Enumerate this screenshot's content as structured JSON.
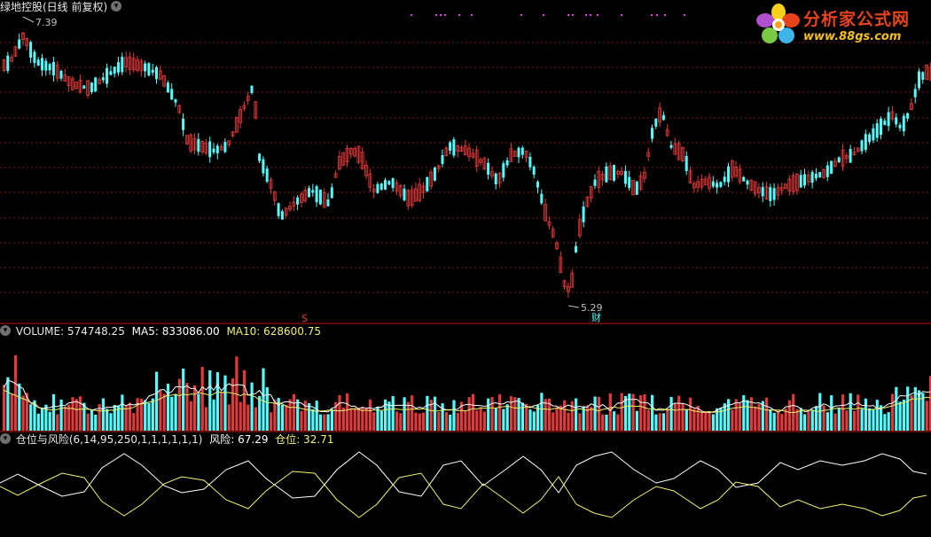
{
  "main_panel": {
    "title": "绿地控股(日线 前复权)",
    "high_label": "7.39",
    "low_label": "5.29",
    "marker_s": "S",
    "marker_cai": "财",
    "colors": {
      "up": "#e23a3a",
      "down": "#53fdfd",
      "grid": "#7a1a1a",
      "divider": "#c01010"
    }
  },
  "volume_panel": {
    "label": "VOLUME: 574748.25",
    "ma5": "MA5: 833086.00",
    "ma10": "MA10: 628600.75",
    "colors": {
      "ma5": "#ffffff",
      "ma10": "#f2f26b"
    }
  },
  "indicator_panel": {
    "name": "仓位与风险(6,14,95,250,1,1,1,1,1,1)",
    "risk": "风险: 67.29",
    "position": "仓位: 32.71",
    "colors": {
      "risk": "#ffffff",
      "position": "#f2f26b"
    }
  },
  "logo": {
    "title": "分析家公式网",
    "url": "www.88gs.com"
  },
  "icons": {
    "collapse": "chevron-down-icon",
    "logo_flower": "flower-logo-icon"
  }
}
